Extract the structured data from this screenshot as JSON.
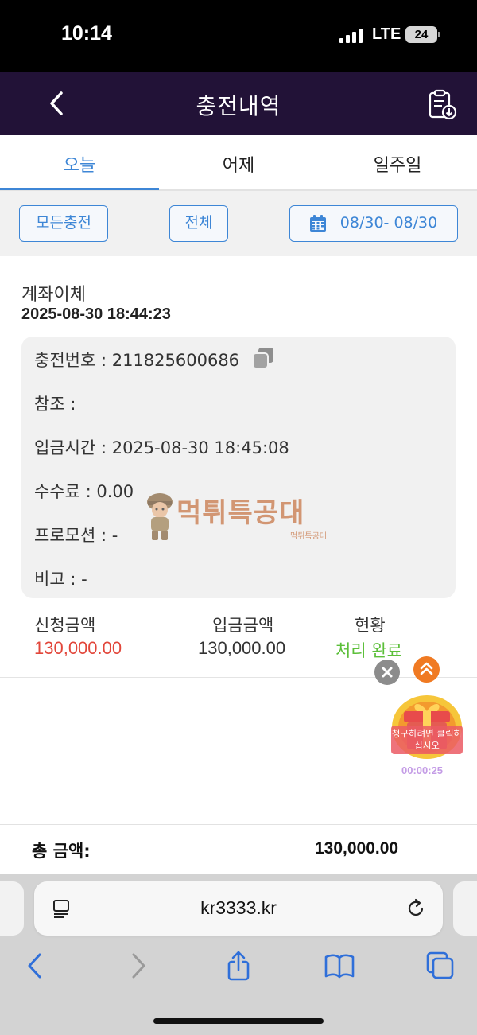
{
  "status": {
    "time": "10:14",
    "network": "LTE",
    "battery": "24"
  },
  "header": {
    "title": "충전내역",
    "back_icon": "chevron-left-icon",
    "export_icon": "clipboard-download-icon"
  },
  "tabs": [
    {
      "label": "오늘",
      "active": true
    },
    {
      "label": "어제",
      "active": false
    },
    {
      "label": "일주일",
      "active": false
    }
  ],
  "filters": {
    "type_label": "모든충전",
    "status_label": "전체",
    "date_range": "08/30- 08/30"
  },
  "record": {
    "method": "계좌이체",
    "datetime": "2025-08-30 18:44:23",
    "details": {
      "charge_no": "충전번호 : 211825600686",
      "reference": "참조 :",
      "deposit_time": "입금시간 : 2025-08-30 18:45:08",
      "fee": "수수료 : 0.00",
      "promotion": "프로모션 : -",
      "note": "비고 : -"
    },
    "columns": {
      "requested_label": "신청금액",
      "requested_value": "130,000.00",
      "deposited_label": "입금금액",
      "deposited_value": "130,000.00",
      "status_label": "현황",
      "status_value": "처리 완료"
    }
  },
  "watermark": {
    "title": "먹튀특공대",
    "sub": "먹튀특공대"
  },
  "promo": {
    "gift_label": "청구하려면 클릭하십시오",
    "timer": "00:00:25"
  },
  "total": {
    "label": "총 금액:",
    "value": "130,000.00"
  },
  "browser": {
    "url": "kr3333.kr"
  },
  "colors": {
    "header_bg": "#221237",
    "accent": "#3d86d6",
    "amount_red": "#e2463a",
    "status_green": "#5cbf3a"
  }
}
